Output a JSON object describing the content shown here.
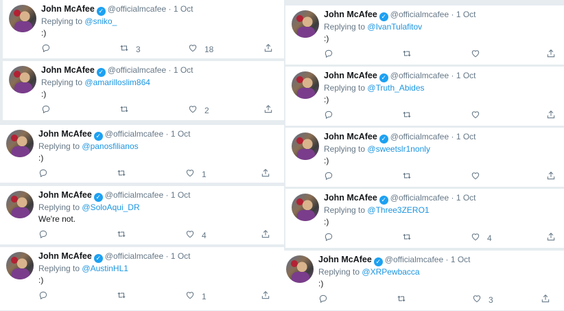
{
  "author": {
    "name": "John McAfee",
    "handle": "@officialmcafee",
    "date": "1 Oct",
    "verified_mark": "✓",
    "dot": "·"
  },
  "replying_prefix": "Replying to",
  "tweets": [
    {
      "mention": "@sniko_",
      "text": ":)",
      "retweets": "3",
      "likes": "18"
    },
    {
      "mention": "@amarilloslim864",
      "text": ":)",
      "retweets": "",
      "likes": "2"
    },
    {
      "mention": "@panosfilianos",
      "text": ":)",
      "retweets": "",
      "likes": "1"
    },
    {
      "mention": "@SoloAqui_DR",
      "text": "We're not.",
      "retweets": "",
      "likes": "4"
    },
    {
      "mention": "@AustinHL1",
      "text": ":)",
      "retweets": "",
      "likes": "1"
    },
    {
      "mention": "@IvanTulafitov",
      "text": ":)",
      "retweets": "",
      "likes": ""
    },
    {
      "mention": "@Truth_Abides",
      "text": ":)",
      "retweets": "",
      "likes": ""
    },
    {
      "mention": "@sweetslr1nonly",
      "text": ":)",
      "retweets": "",
      "likes": ""
    },
    {
      "mention": "@Three3ZERO1",
      "text": ":)",
      "retweets": "",
      "likes": "4"
    },
    {
      "mention": "@XRPewbacca",
      "text": ":)",
      "retweets": "",
      "likes": "3"
    }
  ],
  "icons": {
    "reply": "reply-icon",
    "retweet": "retweet-icon",
    "like": "heart-icon",
    "share": "share-icon"
  },
  "colors": {
    "link": "#1b95e0",
    "verified": "#1da1f2",
    "muted": "#657786"
  }
}
